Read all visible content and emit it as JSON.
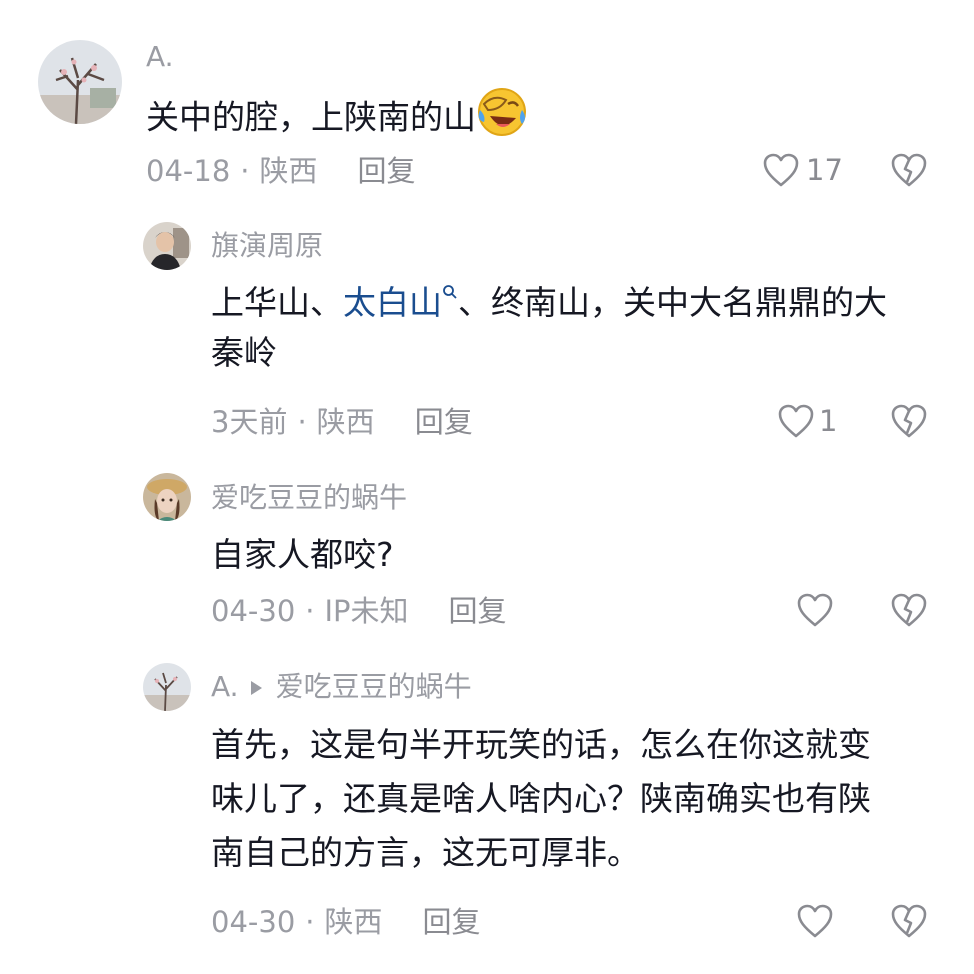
{
  "comments": [
    {
      "username": "A.",
      "text_prefix": "关中的腔，上陕南的山",
      "emoji": "face-laughing-tears-icon",
      "date": "04-18",
      "location": "陕西",
      "reply_label": "回复",
      "likes": "17"
    },
    {
      "username": "旗演周原",
      "text_part1": "上华山、",
      "link_text": "太白山",
      "text_part2": "、终南山，关中大名鼎鼎的大",
      "text_line2": "秦岭",
      "date": "3天前",
      "location": "陕西",
      "reply_label": "回复",
      "likes": "1"
    },
    {
      "username": "爱吃豆豆的蜗牛",
      "text": "自家人都咬?",
      "date": "04-30",
      "location": "IP未知",
      "reply_label": "回复",
      "likes": ""
    },
    {
      "username": "A.",
      "reply_to": "爱吃豆豆的蜗牛",
      "text_line1": "首先，这是句半开玩笑的话，怎么在你这就变",
      "text_line2": "味儿了，还真是啥人啥内心？陕南确实也有陕",
      "text_line3": "南自己的方言，这无可厚非。",
      "date": "04-30",
      "location": "陕西",
      "reply_label": "回复",
      "likes": ""
    }
  ],
  "separator": "·",
  "colors": {
    "text": "#161823",
    "muted": "#9a9ca3",
    "link": "#1a4d8f"
  }
}
